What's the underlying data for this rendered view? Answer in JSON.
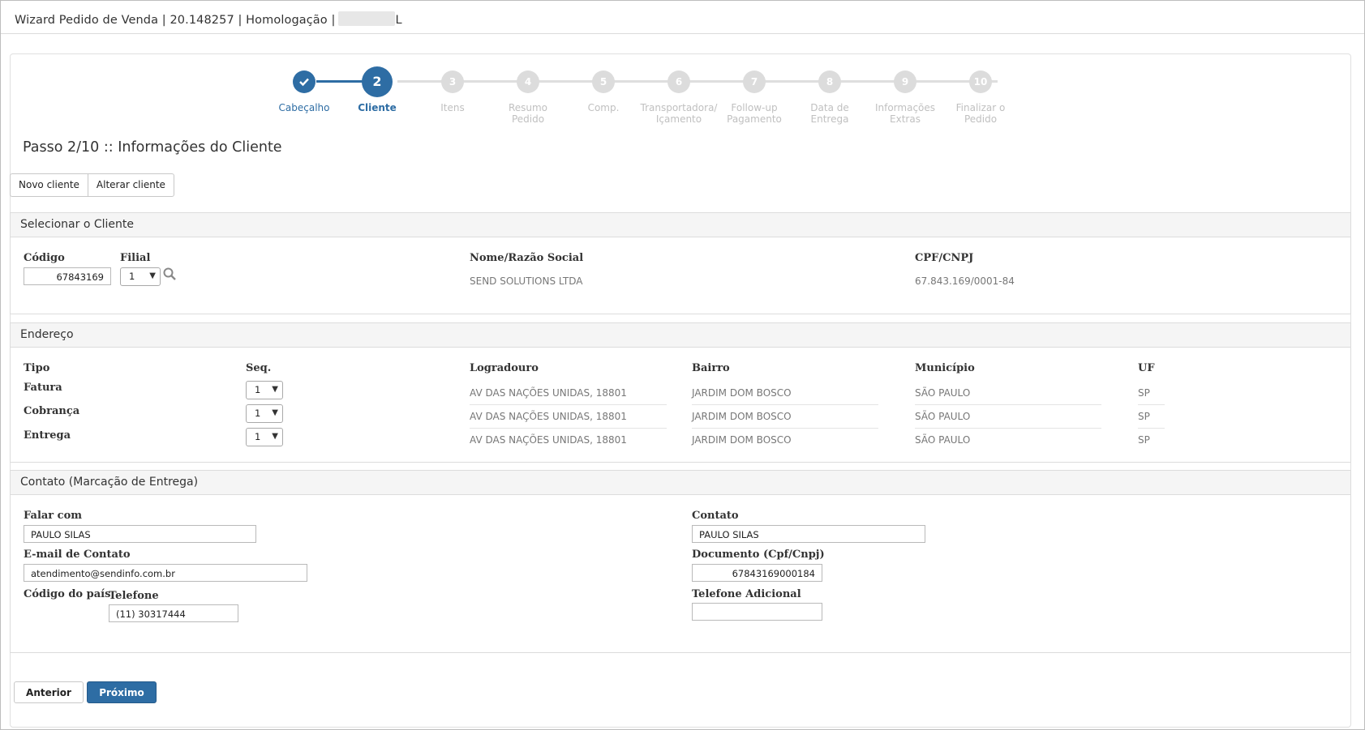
{
  "window": {
    "title": "Wizard Pedido de Venda | 20.148257 | Homologação |",
    "title_suffix": "L"
  },
  "stepper": [
    {
      "num": "1",
      "label": "Cabeçalho",
      "state": "done"
    },
    {
      "num": "2",
      "label": "Cliente",
      "state": "current"
    },
    {
      "num": "3",
      "label": "Itens",
      "state": "todo"
    },
    {
      "num": "4",
      "label": "Resumo Pedido",
      "state": "todo"
    },
    {
      "num": "5",
      "label": "Comp.",
      "state": "todo"
    },
    {
      "num": "6",
      "label": "Transportadora/ Içamento",
      "state": "todo"
    },
    {
      "num": "7",
      "label": "Follow-up Pagamento",
      "state": "todo"
    },
    {
      "num": "8",
      "label": "Data de Entrega",
      "state": "todo"
    },
    {
      "num": "9",
      "label": "Informações Extras",
      "state": "todo"
    },
    {
      "num": "10",
      "label": "Finalizar o Pedido",
      "state": "todo"
    }
  ],
  "step_heading": "Passo 2/10 :: Informações do Cliente",
  "toolbar": {
    "novo_cliente": "Novo cliente",
    "alterar_cliente": "Alterar cliente"
  },
  "cliente": {
    "header": "Selecionar o Cliente",
    "codigo_label": "Código",
    "codigo_value": "67843169",
    "filial_label": "Filial",
    "filial_value": "1",
    "nome_label": "Nome/Razão Social",
    "nome_value": "SEND SOLUTIONS LTDA",
    "cpf_label": "CPF/CNPJ",
    "cpf_value": "67.843.169/0001-84"
  },
  "endereco": {
    "header": "Endereço",
    "columns": {
      "tipo": "Tipo",
      "seq": "Seq.",
      "logradouro": "Logradouro",
      "bairro": "Bairro",
      "municipio": "Município",
      "uf": "UF"
    },
    "rows": [
      {
        "tipo": "Fatura",
        "seq": "1",
        "logradouro": "AV DAS NAÇÕES UNIDAS, 18801",
        "bairro": "JARDIM DOM BOSCO",
        "municipio": "SÃO PAULO",
        "uf": "SP"
      },
      {
        "tipo": "Cobrança",
        "seq": "1",
        "logradouro": "AV DAS NAÇÕES UNIDAS, 18801",
        "bairro": "JARDIM DOM BOSCO",
        "municipio": "SÃO PAULO",
        "uf": "SP"
      },
      {
        "tipo": "Entrega",
        "seq": "1",
        "logradouro": "AV DAS NAÇÕES UNIDAS, 18801",
        "bairro": "JARDIM DOM BOSCO",
        "municipio": "SÃO PAULO",
        "uf": "SP"
      }
    ]
  },
  "contato": {
    "header": "Contato (Marcação de Entrega)",
    "falar_com_label": "Falar com",
    "falar_com_value": "PAULO SILAS",
    "email_label": "E-mail de Contato",
    "email_value": "atendimento@sendinfo.com.br",
    "codigo_pais_label": "Código do país",
    "telefone_label": "Telefone",
    "telefone_value": "(11) 30317444",
    "contato_label": "Contato",
    "contato_value": "PAULO SILAS",
    "documento_label": "Documento (Cpf/Cnpj)",
    "documento_value": "67843169000184",
    "telefone_adicional_label": "Telefone Adicional",
    "telefone_adicional_value": ""
  },
  "footer": {
    "anterior": "Anterior",
    "proximo": "Próximo"
  },
  "colors": {
    "primary": "#2e6da4",
    "inactive_step": "#dcdcdc"
  }
}
